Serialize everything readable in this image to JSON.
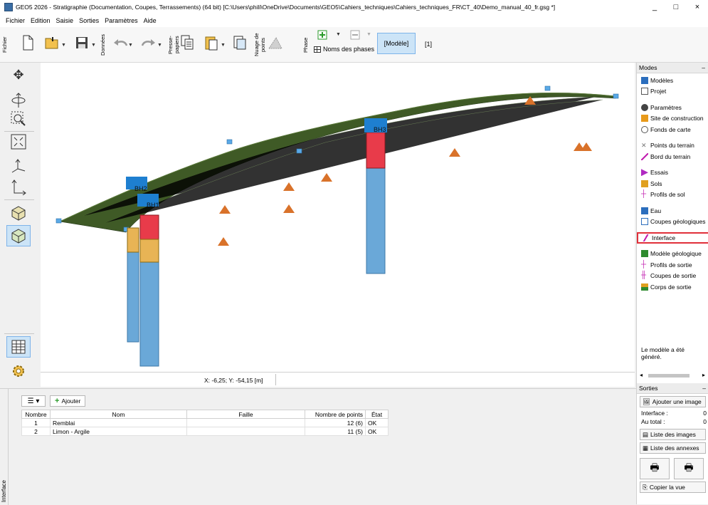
{
  "window": {
    "title": "GEO5 2026 - Stratigraphie (Documentation, Coupes, Terrassements) (64 bit) [C:\\Users\\phili\\OneDrive\\Documents\\GEO5\\Cahiers_techniques\\Cahiers_techniques_FR\\CT_40\\Demo_manual_40_fr.gsg *]",
    "minimize": "_",
    "maximize": "□",
    "close": "×"
  },
  "menu": [
    "Fichier",
    "Edition",
    "Saisie",
    "Sorties",
    "Paramètres",
    "Aide"
  ],
  "toolbar": {
    "group_fichier": "Fichier",
    "group_donnees": "Données",
    "group_presse": "Presse-papiers",
    "group_nuage": "Nuage de points",
    "group_phase": "Phase",
    "phase_names_label": "Noms des phases",
    "model_button": "[Modèle]",
    "stage_tag": "[1]"
  },
  "viewport": {
    "boreholes": [
      {
        "label": "BH1"
      },
      {
        "label": "BH2"
      },
      {
        "label": "BH3"
      }
    ],
    "coordinates": "X: -6,25; Y: -54,15 [m]"
  },
  "modes": {
    "header": "Modes",
    "items": [
      {
        "label": "Modèles",
        "icon": "models-icon",
        "color": "#2c6ebd"
      },
      {
        "label": "Projet",
        "icon": "project-icon",
        "color": "#555555"
      },
      {
        "label": "Paramètres",
        "icon": "settings-icon",
        "color": "#444444"
      },
      {
        "label": "Site de construction",
        "icon": "construction-site-icon",
        "color": "#e89a1a"
      },
      {
        "label": "Fonds de carte",
        "icon": "map-background-icon",
        "color": "#555555"
      },
      {
        "label": "Points du terrain",
        "icon": "terrain-points-icon",
        "color": "#777777"
      },
      {
        "label": "Bord du terrain",
        "icon": "terrain-edge-icon",
        "color": "#c21fb0"
      },
      {
        "label": "Essais",
        "icon": "tests-icon",
        "color": "#b02ac2"
      },
      {
        "label": "Sols",
        "icon": "soils-icon",
        "color": "#e0a020"
      },
      {
        "label": "Profils de sol",
        "icon": "soil-profiles-icon",
        "color": "#c21fb0"
      },
      {
        "label": "Eau",
        "icon": "water-icon",
        "color": "#2c6ebd"
      },
      {
        "label": "Coupes géologiques",
        "icon": "geological-sections-icon",
        "color": "#2c6ebd"
      },
      {
        "label": "Interface",
        "icon": "interface-icon",
        "color": "#c21fb0"
      },
      {
        "label": "Modèle géologique",
        "icon": "geological-model-icon",
        "color": "#2e8b2e"
      },
      {
        "label": "Profils de sortie",
        "icon": "output-profiles-icon",
        "color": "#c21fb0"
      },
      {
        "label": "Coupes de sortie",
        "icon": "output-sections-icon",
        "color": "#c21fb0"
      },
      {
        "label": "Corps de sortie",
        "icon": "output-bodies-icon",
        "color": "#e0a020"
      }
    ],
    "selected": "Interface",
    "message": "Le modèle a été généré."
  },
  "sorties": {
    "header": "Sorties",
    "add_image": "Ajouter une image",
    "interface_label": "Interface :",
    "interface_value": "0",
    "total_label": "Au total :",
    "total_value": "0",
    "list_images": "Liste des images",
    "list_annexes": "Liste des annexes",
    "copy_view": "Copier la vue"
  },
  "bottom": {
    "side_tab": "Interface",
    "add_button": "Ajouter",
    "columns": [
      "Nombre",
      "Nom",
      "Faille",
      "Nombre de points",
      "État"
    ],
    "rows": [
      {
        "num": "1",
        "nom": "Remblai",
        "faille": "",
        "points": "12 (6)",
        "etat": "OK"
      },
      {
        "num": "2",
        "nom": "Limon - Argile",
        "faille": "",
        "points": "11 (5)",
        "etat": "OK"
      }
    ]
  }
}
